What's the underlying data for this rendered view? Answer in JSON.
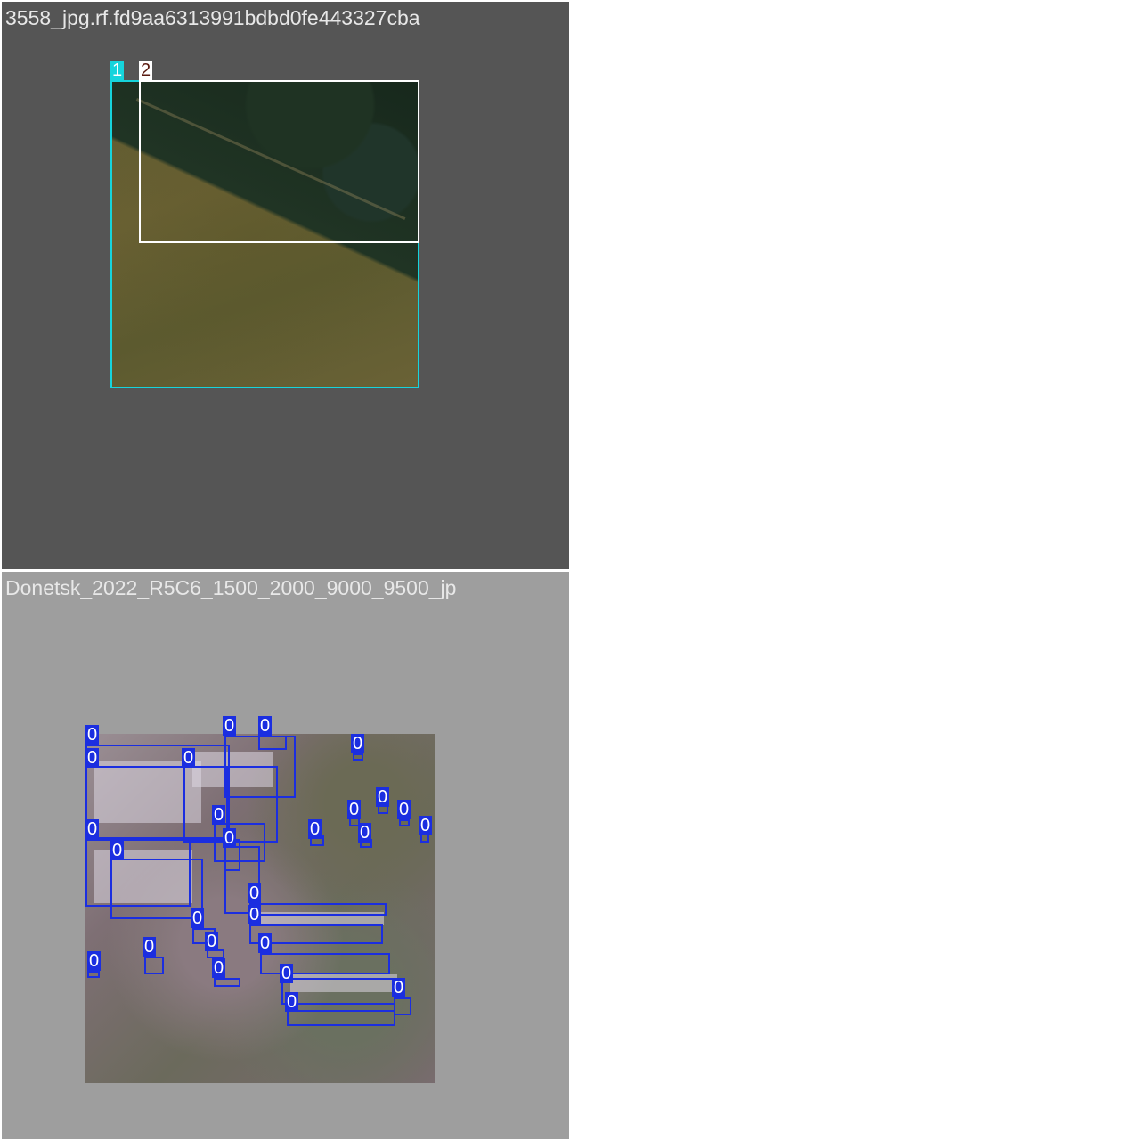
{
  "panels": [
    {
      "title": "3558_jpg.rf.fd9aa6313991bdbd0fe443327cba",
      "labels": [
        "1",
        "2"
      ]
    },
    {
      "title": "Donetsk_2022_R5C6_1500_2000_9000_9500_jp",
      "label": "0"
    }
  ],
  "colors": {
    "panel1_background": "#555555",
    "panel2_background": "#9e9e9e",
    "class_1": "#16d4dc",
    "class_2": "#ffffff",
    "class_0": "#1b2ee0"
  }
}
